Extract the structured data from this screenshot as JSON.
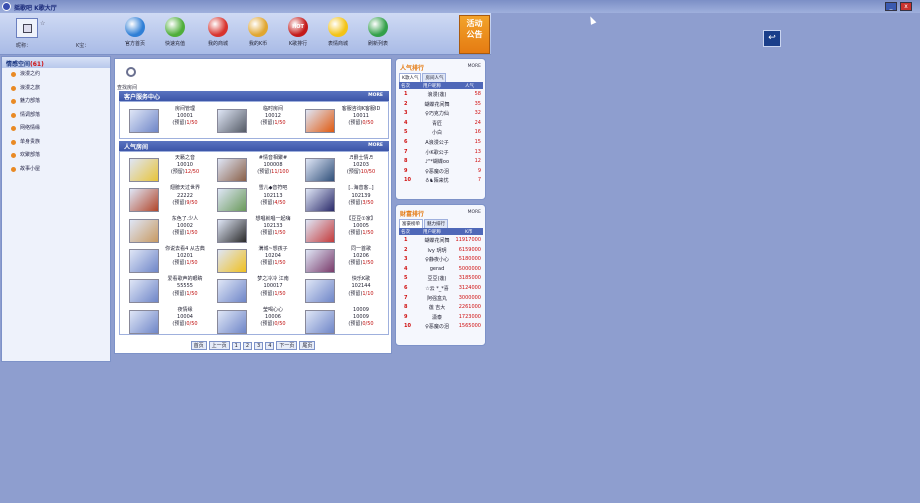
{
  "window": {
    "title": "摇歌吧 K歌大厅",
    "minimize": "_",
    "close": "x"
  },
  "toolbar": {
    "small_label": "☆",
    "user_label": "昵称：",
    "vip_label": "K宝：",
    "buttons": [
      {
        "label": "官方首页",
        "icon": "globe-icon",
        "color": "#2f7fd6"
      },
      {
        "label": "快速充值",
        "icon": "download-icon",
        "color": "#4fae3a"
      },
      {
        "label": "我的商城",
        "icon": "shopping-basket-icon",
        "color": "#d8342e"
      },
      {
        "label": "我的K币",
        "icon": "coins-icon",
        "color": "#e0a630"
      },
      {
        "label": "K歌排行",
        "icon": "hot-icon",
        "color": "#c41a1a"
      },
      {
        "label": "表情商城",
        "icon": "smiley-icon",
        "color": "#f3c316"
      },
      {
        "label": "刷新列表",
        "icon": "refresh-icon",
        "color": "#33a04a"
      }
    ],
    "hot_text": "HOT",
    "announcement": "活动公告"
  },
  "sidebar": {
    "title": "情感空间",
    "count": "(61)",
    "items": [
      "浪漫之约",
      "浪漫之旅",
      "魅力部落",
      "情调部落",
      "网络情缘",
      "单身贵族",
      "欢聚部落",
      "故事小屋"
    ]
  },
  "main": {
    "search_label": "查找房间",
    "service_title": "客户服务中心",
    "more": "MORE",
    "service_rooms": [
      {
        "name": "房间管理",
        "id": "10001",
        "status": "(预留)",
        "count": "1/50",
        "thumb": "#6f86c8"
      },
      {
        "name": "临时房间",
        "id": "10012",
        "status": "(预留)",
        "count": "1/50",
        "thumb": "#555b66"
      },
      {
        "name": "客服咨询K客服ID",
        "id": "10011",
        "status": "(预留)",
        "count": "0/50",
        "thumb": "#e05a10"
      }
    ],
    "popular_title": "人气房间",
    "rooms": [
      {
        "name": "天籁之音",
        "id": "10010",
        "status": "(预留)",
        "count": "12/50",
        "thumb": "#e8c43a"
      },
      {
        "name": "#情音相聚#",
        "id": "100008",
        "status": "(预留)",
        "count": "11/100",
        "thumb": "#8a6048"
      },
      {
        "name": "♬爵士情♬",
        "id": "10203",
        "status": "(预留)",
        "count": "10/50",
        "thumb": "#30507a"
      },
      {
        "name": "翅膀天过世界",
        "id": "22222",
        "status": "(预留)",
        "count": "9/50",
        "thumb": "#b2462a"
      },
      {
        "name": "雪儿◆音符吧",
        "id": "102113",
        "status": "(预留)",
        "count": "4/50",
        "thumb": "#6a9a5a"
      },
      {
        "name": "[..海音客..]",
        "id": "102139",
        "status": "(预留)",
        "count": "3/50",
        "thumb": "#2a2a6a"
      },
      {
        "name": "东色了.少人",
        "id": "10002",
        "status": "(预留)",
        "count": "1/50",
        "thumb": "#c89a62"
      },
      {
        "name": "想唱就唱一起嗨",
        "id": "102133",
        "status": "(预留)",
        "count": "1/50",
        "thumb": "#2a2a2a"
      },
      {
        "name": "【豆豆①家】",
        "id": "10005",
        "status": "(预留)",
        "count": "1/50",
        "thumb": "#c43a3a"
      },
      {
        "name": "你说去看4 从古典",
        "id": "10201",
        "status": "(预留)",
        "count": "1/50",
        "thumb": "#6f86c8"
      },
      {
        "name": "满城~想孩子",
        "id": "10204",
        "status": "(预留)",
        "count": "1/50",
        "thumb": "#f0c020"
      },
      {
        "name": "同一首歌",
        "id": "10206",
        "status": "(预留)",
        "count": "1/50",
        "thumb": "#7a3a6a"
      },
      {
        "name": "爱看歌声的眼睛",
        "id": "55555",
        "status": "(预留)",
        "count": "1/50",
        "thumb": "#6f86c8"
      },
      {
        "name": "梦之冷冷 江南",
        "id": "100017",
        "status": "(预留)",
        "count": "1/50",
        "thumb": "#6f86c8"
      },
      {
        "name": "快乐K歌",
        "id": "102144",
        "status": "(预留)",
        "count": "1/10",
        "thumb": "#6f86c8"
      },
      {
        "name": "夜情缘",
        "id": "10004",
        "status": "(预留)",
        "count": "0/50",
        "thumb": "#6f86c8"
      },
      {
        "name": "莹喝心心",
        "id": "10006",
        "status": "(预留)",
        "count": "0/50",
        "thumb": "#6f86c8"
      },
      {
        "name": "10009",
        "id": "10009",
        "status": "(预留)",
        "count": "0/50",
        "thumb": "#6f86c8"
      }
    ],
    "pager": [
      "首页",
      "上一页",
      "1",
      "2",
      "3",
      "4",
      "下一页",
      "尾页"
    ]
  },
  "popularity_rank": {
    "title": "人气排行",
    "more": "MORE",
    "tabs": [
      "K歌人气",
      "房间人气"
    ],
    "headers": [
      "名次",
      "用户昵称",
      "人气"
    ],
    "rows": [
      {
        "rank": "1",
        "name": "浪漫(莲)",
        "value": "58"
      },
      {
        "rank": "2",
        "name": "蝴蝶花间舞",
        "value": "35"
      },
      {
        "rank": "3",
        "name": "♀巧克力仙",
        "value": "32"
      },
      {
        "rank": "4",
        "name": "青匠",
        "value": "24"
      },
      {
        "rank": "5",
        "name": "小白",
        "value": "16"
      },
      {
        "rank": "6",
        "name": "A浪漫公子",
        "value": "15"
      },
      {
        "rank": "7",
        "name": "小K歌公子",
        "value": "13"
      },
      {
        "rank": "8",
        "name": "♪\"*蝴蝶oo",
        "value": "12"
      },
      {
        "rank": "9",
        "name": "♀恶魔の泪",
        "value": "9"
      },
      {
        "rank": "10",
        "name": "♁♞陌来忧",
        "value": "7"
      }
    ]
  },
  "wealth_rank": {
    "title": "财富排行",
    "more": "MORE",
    "tabs": [
      "富豪榜单",
      "魅力排行"
    ],
    "headers": [
      "名次",
      "用户昵称",
      "K币"
    ],
    "rows": [
      {
        "rank": "1",
        "name": "蝴蝶花间舞",
        "value": "11917000"
      },
      {
        "rank": "2",
        "name": "lvy 玥玥",
        "value": "6159000"
      },
      {
        "rank": "3",
        "name": "♀静夜小心",
        "value": "5180000"
      },
      {
        "rank": "4",
        "name": "gerad",
        "value": "5000000"
      },
      {
        "rank": "5",
        "name": "豆豆(莲)",
        "value": "3185000"
      },
      {
        "rank": "6",
        "name": "☆云 *_*喜",
        "value": "3124000"
      },
      {
        "rank": "7",
        "name": "阿强盒丸",
        "value": "3000000"
      },
      {
        "rank": "8",
        "name": "莲 吉大",
        "value": "2261000"
      },
      {
        "rank": "9",
        "name": "潇泰",
        "value": "1723000"
      },
      {
        "rank": "10",
        "name": "♀恶魔の泪",
        "value": "1565000"
      }
    ]
  },
  "desktop": {
    "icon": "browser-shortcut-icon",
    "glyph": "↩"
  }
}
